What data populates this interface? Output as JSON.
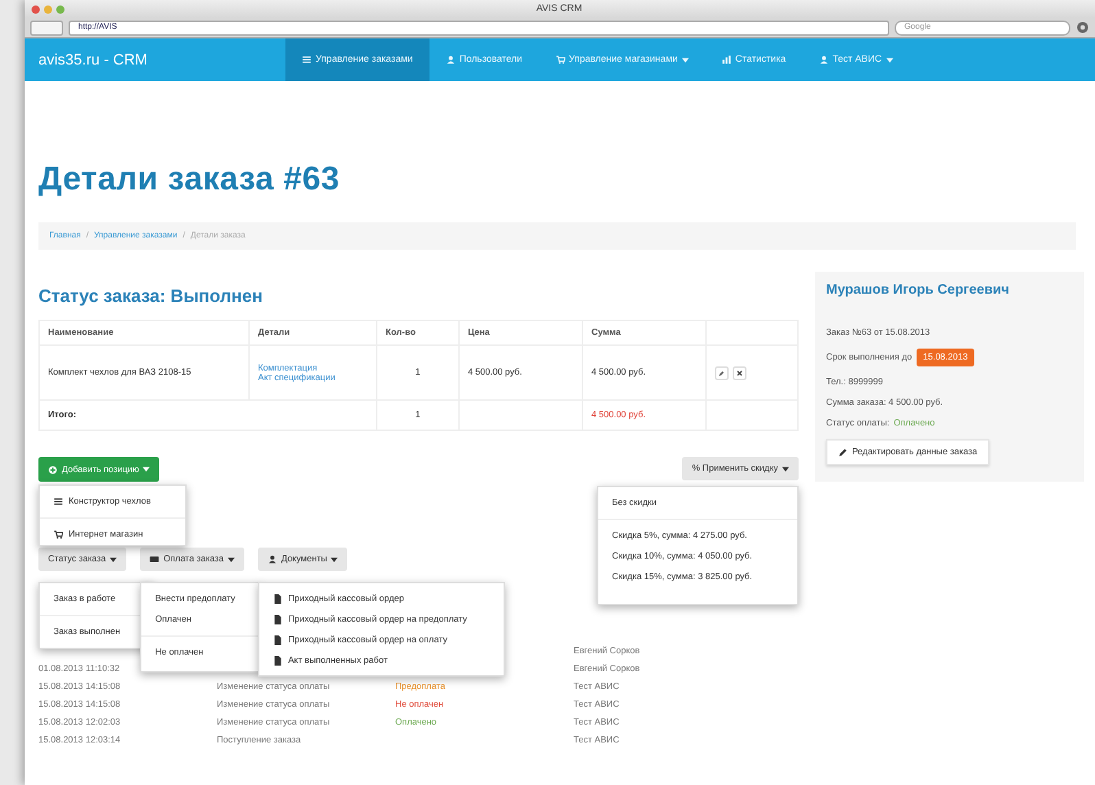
{
  "window": {
    "title": "AVIS CRM"
  },
  "browser": {
    "url": "http://AVIS",
    "search_placeholder": "Google"
  },
  "navbar": {
    "brand": "avis35.ru - CRM",
    "items": [
      {
        "label": "Управление заказами",
        "selected": true,
        "caret": false
      },
      {
        "label": "Пользователи",
        "selected": false,
        "caret": false
      },
      {
        "label": "Управление магазинами",
        "selected": false,
        "caret": true
      },
      {
        "label": "Статистика",
        "selected": false,
        "caret": false
      },
      {
        "label": "Тест АВИС",
        "selected": false,
        "caret": true
      }
    ]
  },
  "page_title": "Детали заказа #63",
  "breadcrumb": {
    "separator": "/",
    "items": [
      "Главная",
      "Управление заказами",
      "Детали заказа"
    ]
  },
  "status_heading": "Статус заказа: Выполнен",
  "order_table": {
    "columns": [
      "Наименование",
      "Детали",
      "Кол-во",
      "Цена",
      "Сумма"
    ],
    "rows": [
      {
        "name": "Комплект чехлов для ВАЗ 2108-15",
        "details": [
          "Комплектация",
          "Акт спецификации"
        ],
        "qty": "1",
        "price": "4 500.00 руб.",
        "sum": "4 500.00 руб."
      }
    ],
    "total": {
      "label": "Итого:",
      "qty": "1",
      "sum": "4 500.00 руб."
    }
  },
  "add_button": {
    "label": "Добавить позицию",
    "menu": [
      {
        "label": "Конструктор чехлов",
        "divider_before": false
      },
      {
        "label": "Интернет магазин",
        "divider_before": true
      }
    ]
  },
  "discount_button": {
    "label": "% Применить скидку",
    "menu": [
      {
        "label": "Без скидки",
        "divider_before": false
      },
      {
        "label": "Скидка 5%, сумма: 4 275.00 руб.",
        "divider_before": true
      },
      {
        "label": "Скидка 10%, сумма: 4 050.00 руб.",
        "divider_before": false
      },
      {
        "label": "Скидка 15%, сумма: 3 825.00 руб.",
        "divider_before": false
      }
    ]
  },
  "status_button": {
    "label": "Статус заказа",
    "menu": [
      {
        "label": "Заказ в работе",
        "divider_before": false
      },
      {
        "label": "Заказ выполнен",
        "divider_before": true
      }
    ]
  },
  "payment_button": {
    "label": "Оплата заказа",
    "menu": [
      {
        "label": "Внести предоплату",
        "divider_before": false
      },
      {
        "label": "Оплачен",
        "divider_before": false
      },
      {
        "label": "Не оплачен",
        "divider_before": true
      }
    ]
  },
  "documents_button": {
    "label": "Документы",
    "menu": [
      {
        "label": "Приходный кассовый ордер",
        "divider_before": false
      },
      {
        "label": "Приходный кассовый ордер на предоплату",
        "divider_before": false
      },
      {
        "label": "Приходный кассовый ордер на оплату",
        "divider_before": false
      },
      {
        "label": "Акт выполненных работ",
        "divider_before": false
      }
    ]
  },
  "history": [
    {
      "user": "Евгений Сорков"
    },
    {
      "date": "01.08.2013 11:10:32",
      "user": "Евгений Сорков"
    },
    {
      "date": "15.08.2013 14:15:08",
      "action": "Изменение статуса оплаты",
      "status": "Предоплата",
      "color": "#e8902a",
      "user": "Тест АВИС"
    },
    {
      "date": "15.08.2013 14:15:08",
      "action": "Изменение статуса оплаты",
      "status": "Не оплачен",
      "color": "#e04a3a",
      "user": "Тест АВИС"
    },
    {
      "date": "15.08.2013 12:02:03",
      "action": "Изменение статуса оплаты",
      "status": "Оплачено",
      "color": "#6aa84f",
      "user": "Тест АВИС"
    },
    {
      "date": "15.08.2013 12:03:14",
      "action": "Поступление заказа",
      "user": "Тест АВИС"
    }
  ],
  "customer": {
    "name": "Мурашов Игорь Сергеевич",
    "order": "Заказ №63 от 15.08.2013",
    "deadline_label": "Срок выполнения до",
    "deadline": "15.08.2013",
    "phone": "Тел.: 8999999",
    "total": "Сумма заказа: 4 500.00 руб.",
    "payment_label": "Статус оплаты:",
    "payment_status": "Оплачено",
    "edit_button": "Редактировать данные заказа"
  }
}
